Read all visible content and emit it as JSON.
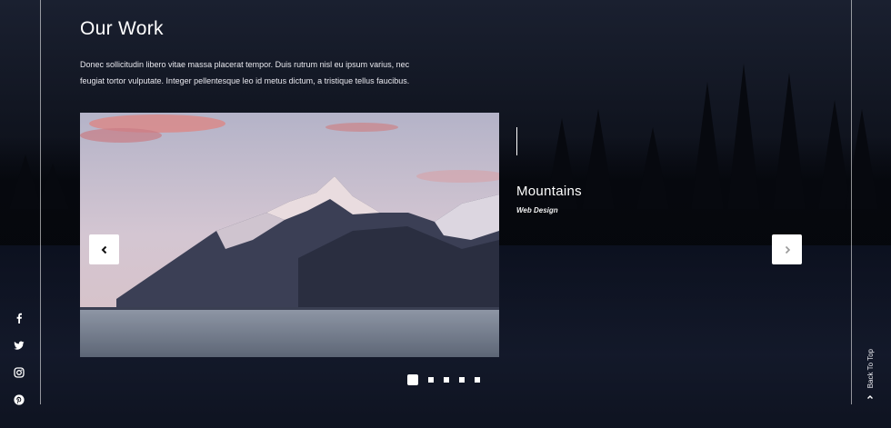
{
  "section": {
    "title": "Our Work",
    "intro": "Donec sollicitudin libero vitae massa placerat tempor. Duis rutrum nisl eu ipsum varius, nec feugiat tortor vulputate. Integer pellentesque leo id metus dictum, a tristique tellus faucibus."
  },
  "slider": {
    "current": {
      "title": "Mountains",
      "category": "Web Design"
    },
    "prev_icon": "chevron-left-icon",
    "next_icon": "chevron-right-icon",
    "slide_count": 5,
    "active_index": 0
  },
  "social": [
    "facebook-icon",
    "twitter-icon",
    "instagram-icon",
    "pinterest-icon"
  ],
  "back_to_top": {
    "label": "Back To Top",
    "icon": "chevron-up-icon"
  },
  "colors": {
    "background": "#0b0e17",
    "text": "#ffffff",
    "button_bg": "#ffffff"
  }
}
